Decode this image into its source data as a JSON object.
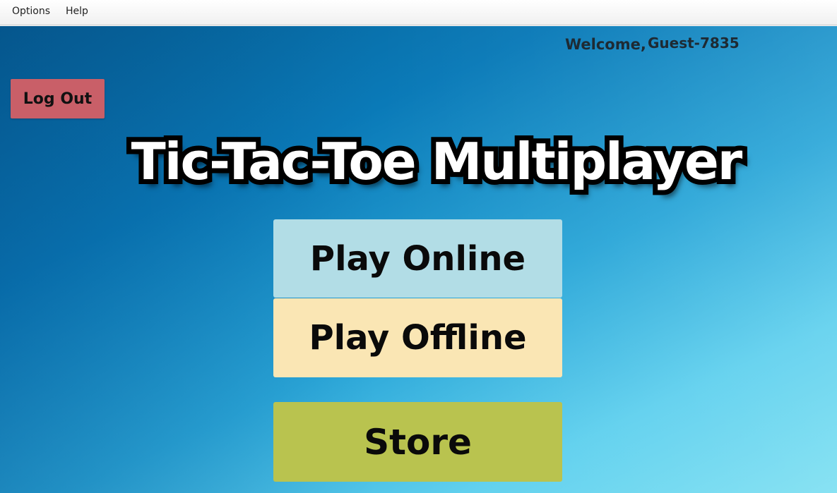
{
  "menubar": {
    "items": [
      {
        "label": "Options"
      },
      {
        "label": "Help"
      }
    ]
  },
  "header": {
    "welcome_label": "Welcome,",
    "username": "Guest-7835"
  },
  "logout": {
    "label": "Log Out"
  },
  "title": "Tic-Tac-Toe Multiplayer",
  "buttons": {
    "play_online": "Play Online",
    "play_offline": "Play Offline",
    "store": "Store"
  },
  "colors": {
    "logout_bg": "#c95f68",
    "online_bg": "#b2dde6",
    "offline_bg": "#fae6b4",
    "store_bg": "#b9c34f",
    "background_dark": "#065f94",
    "background_light": "#7ee0f2"
  }
}
